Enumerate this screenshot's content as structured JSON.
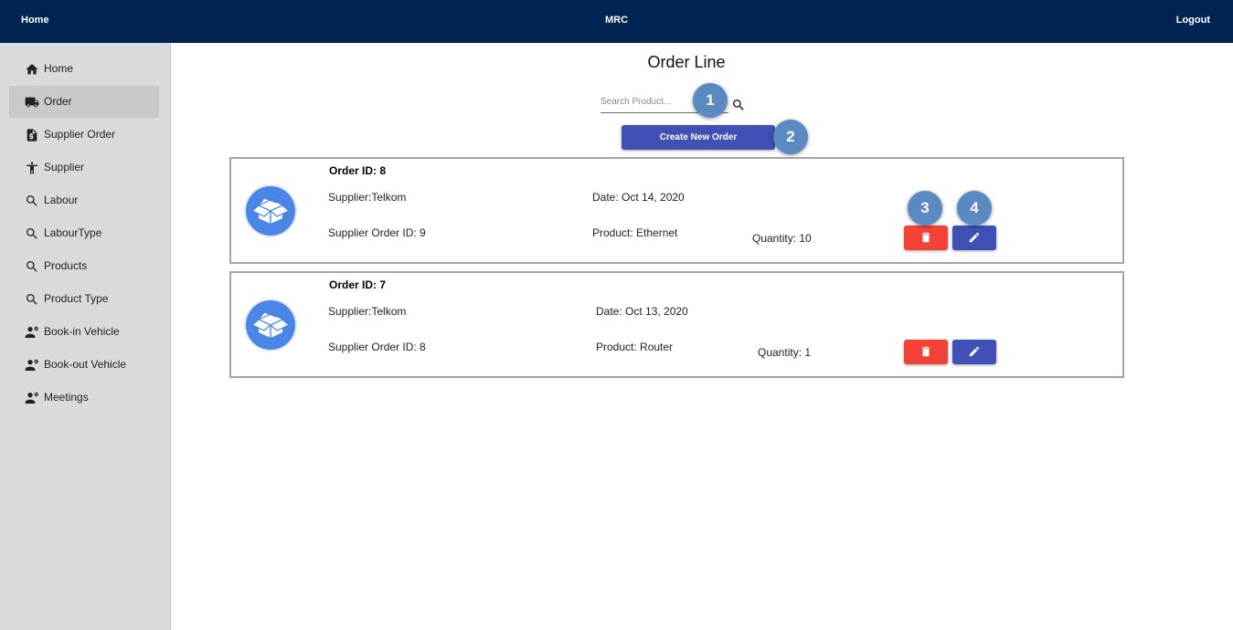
{
  "header": {
    "home_label": "Home",
    "app_title": "MRC",
    "logout_label": "Logout",
    "bg_color": "#002352"
  },
  "sidebar": {
    "items": [
      {
        "label": "Home",
        "icon": "home-icon",
        "active": false
      },
      {
        "label": "Order",
        "icon": "truck-icon",
        "active": true
      },
      {
        "label": "Supplier Order",
        "icon": "invoice-icon",
        "active": false
      },
      {
        "label": "Supplier",
        "icon": "person-icon",
        "active": false
      },
      {
        "label": "Labour",
        "icon": "search-icon",
        "active": false
      },
      {
        "label": "LabourType",
        "icon": "search-icon",
        "active": false
      },
      {
        "label": "Products",
        "icon": "search-icon",
        "active": false
      },
      {
        "label": "Product Type",
        "icon": "search-icon",
        "active": false
      },
      {
        "label": "Book-in Vehicle",
        "icon": "person-settings-icon",
        "active": false
      },
      {
        "label": "Book-out Vehicle",
        "icon": "person-settings-icon",
        "active": false
      },
      {
        "label": "Meetings",
        "icon": "person-settings-icon",
        "active": false
      }
    ]
  },
  "main": {
    "title": "Order Line",
    "search": {
      "placeholder": "Search Product...",
      "value": ""
    },
    "create_button_label": "Create New Order",
    "accent_color": "#3f51b5",
    "delete_color": "#f44336"
  },
  "markers": [
    "1",
    "2",
    "3",
    "4"
  ],
  "orders": [
    {
      "order_id": "Order ID: 8",
      "supplier": "Supplier:Telkom",
      "supplier_order_id": "Supplier Order ID: 9",
      "date": "Date: Oct 14, 2020",
      "product": "Product: Ethernet",
      "quantity": "Quantity: 10",
      "icon": "package-box-icon"
    },
    {
      "order_id": "Order ID: 7",
      "supplier": "Supplier:Telkom",
      "supplier_order_id": "Supplier Order ID: 8",
      "date": "Date: Oct 13, 2020",
      "product": "Product: Router",
      "quantity": "Quantity: 1",
      "icon": "package-box-icon"
    }
  ]
}
